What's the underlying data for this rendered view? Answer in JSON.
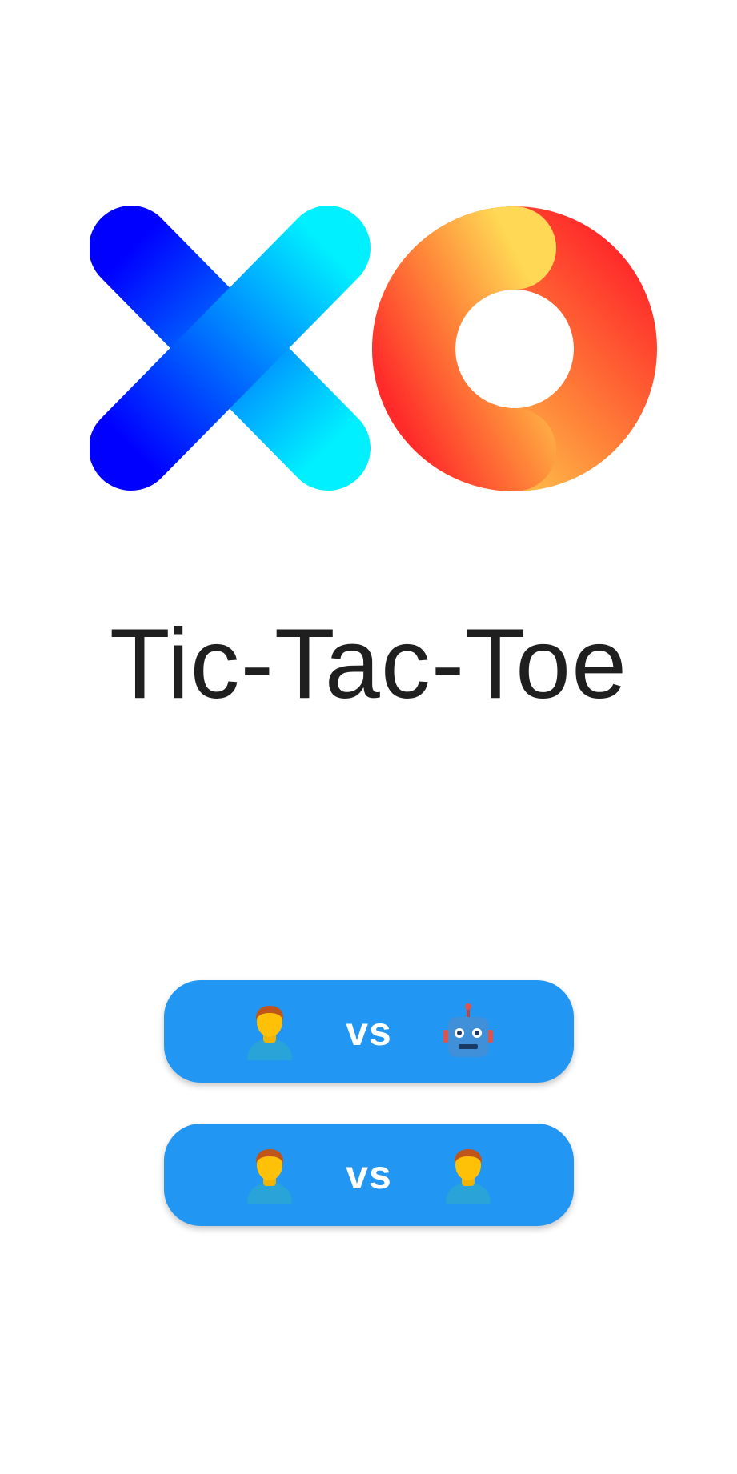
{
  "app": {
    "title": "Tic-Tac-Toe",
    "logo": {
      "x_icon": "x-mark-icon",
      "o_icon": "o-ring-icon",
      "x_colors": [
        "#0000ff",
        "#00f0ff"
      ],
      "o_colors": [
        "#ff2a2a",
        "#ffe05a"
      ]
    }
  },
  "menu": {
    "buttons": [
      {
        "left_icon": "person-icon",
        "label": "vs",
        "right_icon": "robot-icon"
      },
      {
        "left_icon": "person-icon",
        "label": "vs",
        "right_icon": "person-icon"
      }
    ],
    "button_color": "#2196f3"
  }
}
